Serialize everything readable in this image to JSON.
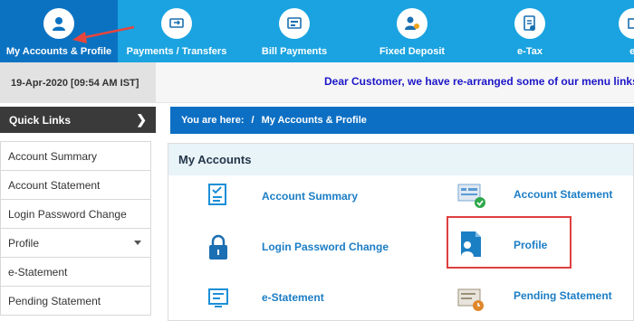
{
  "nav": {
    "items": [
      {
        "label": "My Accounts & Profile",
        "icon": "user-icon"
      },
      {
        "label": "Payments / Transfers",
        "icon": "transfer-icon"
      },
      {
        "label": "Bill Payments",
        "icon": "bill-icon"
      },
      {
        "label": "Fixed Deposit",
        "icon": "deposit-icon"
      },
      {
        "label": "e-Tax",
        "icon": "tax-icon"
      },
      {
        "label": "e-",
        "icon": "more-icon"
      }
    ],
    "active_color": "#0b72c2",
    "bar_color": "#1aa3e0"
  },
  "datetime": "19-Apr-2020 [09:54 AM IST]",
  "marquee": "Dear Customer, we have re-arranged some of our menu links f",
  "quick_links": {
    "title": "Quick Links",
    "items": [
      {
        "label": "Account Summary"
      },
      {
        "label": "Account Statement"
      },
      {
        "label": "Login Password Change"
      },
      {
        "label": "Profile"
      },
      {
        "label": "e-Statement"
      },
      {
        "label": "Pending Statement"
      }
    ]
  },
  "breadcrumb": {
    "prefix": "You are here:",
    "separator": "/",
    "current": "My Accounts & Profile"
  },
  "panel": {
    "title": "My Accounts",
    "links": [
      {
        "label": "Account Summary",
        "icon": "summary-icon"
      },
      {
        "label": "Account Statement",
        "icon": "statement-icon"
      },
      {
        "label": "Login Password Change",
        "icon": "lock-icon"
      },
      {
        "label": "Profile",
        "icon": "profile-icon"
      },
      {
        "label": "e-Statement",
        "icon": "estatement-icon"
      },
      {
        "label": "Pending Statement",
        "icon": "pending-statement-icon"
      }
    ]
  }
}
